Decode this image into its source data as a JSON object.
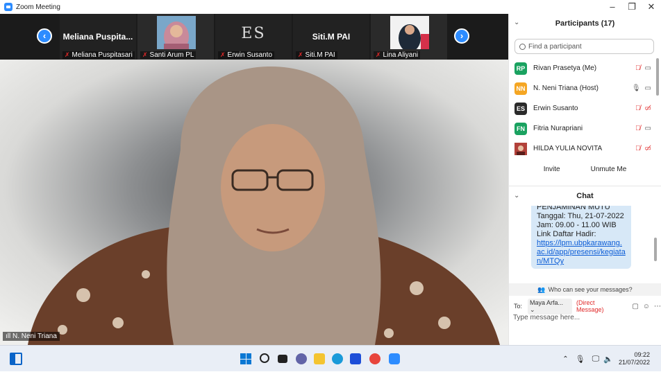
{
  "window": {
    "title": "Zoom Meeting",
    "controls": [
      "–",
      "❐",
      "✕"
    ]
  },
  "strip": {
    "tiles": [
      {
        "big_name": "Meliana  Puspita...",
        "label": "Meliana Puspitasari"
      },
      {
        "big_name": "",
        "label": "Santi Arum PL"
      },
      {
        "big_name": "",
        "logo_text": "ES",
        "label": "Erwin Susanto"
      },
      {
        "big_name": "Siti.M  PAI",
        "label": "Siti.M  PAI"
      },
      {
        "big_name": "",
        "label": "Lina Aliyani"
      }
    ]
  },
  "main_video": {
    "speaker_label": "N. Neni Triana"
  },
  "participants": {
    "title": "Participants (17)",
    "search_placeholder": "Find a participant",
    "list": [
      {
        "initials": "RP",
        "name": "Rivan Prasetya (Me)",
        "color": "#1aa260",
        "mic": "muted",
        "video": "on"
      },
      {
        "initials": "NN",
        "name": "N. Neni Triana (Host)",
        "color": "#f5a623",
        "mic": "on",
        "video": "on"
      },
      {
        "initials": "ES",
        "name": "Erwin Susanto",
        "color": "#2b2b2b",
        "mic": "muted",
        "video": "off"
      },
      {
        "initials": "FN",
        "name": "Fitria Nurapriani",
        "color": "#1aa260",
        "mic": "muted",
        "video": "on"
      },
      {
        "initials": "",
        "name": "HILDA YULIA NOVITA",
        "color": "#b2413a",
        "mic": "muted",
        "video": "off"
      }
    ],
    "invite_label": "Invite",
    "unmute_label": "Unmute Me"
  },
  "chat": {
    "title": "Chat",
    "message_lines": [
      "PENJAMINAN MUTU",
      "Tanggal: Thu, 21-07-2022",
      "Jam: 09.00 - 11.00 WIB",
      "Link Daftar Hadir:"
    ],
    "link_text": "https://lpm.ubpkarawang.ac.id/app/presensi/kegiatan/MTQy",
    "who_can_see": "Who can see your messages?",
    "to_label": "To:",
    "recipient": "Maya Arfa... ⌄",
    "direct_message": "(Direct Message)",
    "placeholder": "Type message here..."
  },
  "taskbar": {
    "time": "09:22",
    "date": "21/07/2022"
  }
}
